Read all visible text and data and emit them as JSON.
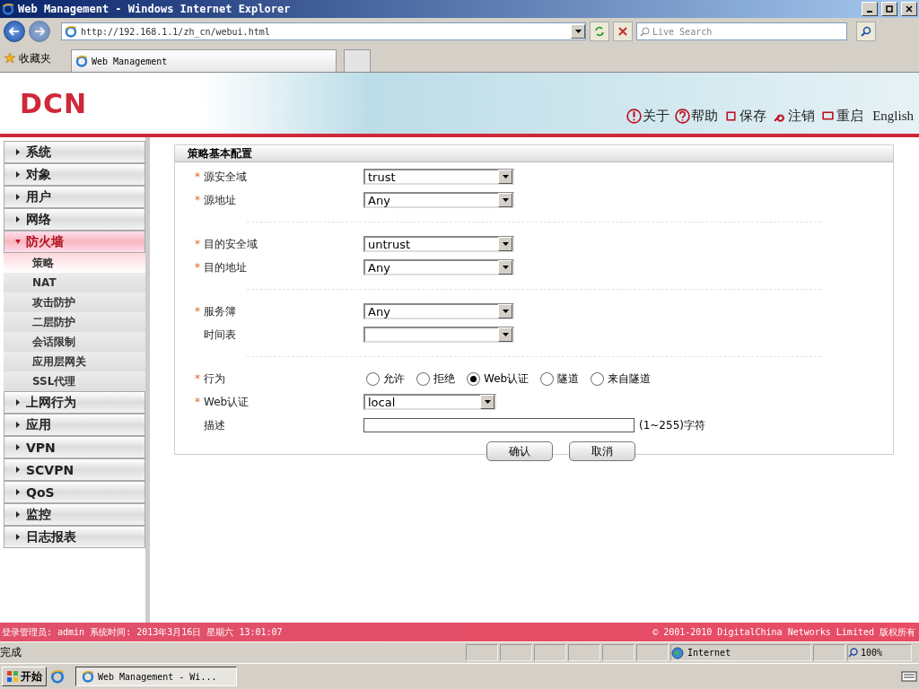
{
  "window": {
    "title": "Web Management - Windows Internet Explorer"
  },
  "browser": {
    "address": "http://192.168.1.1/zh_cn/webui.html",
    "search_placeholder": "Live Search",
    "favorites": "收藏夹",
    "tab": "Web Management"
  },
  "header": {
    "logo": "DCN",
    "actions": [
      {
        "label": "关于"
      },
      {
        "label": "帮助"
      },
      {
        "label": "保存"
      },
      {
        "label": "注销"
      },
      {
        "label": "重启"
      }
    ],
    "language": "English"
  },
  "sidebar": {
    "items": [
      {
        "label": "系统",
        "expanded": false
      },
      {
        "label": "对象",
        "expanded": false
      },
      {
        "label": "用户",
        "expanded": false
      },
      {
        "label": "网络",
        "expanded": false
      },
      {
        "label": "防火墙",
        "expanded": true,
        "children": [
          {
            "label": "策略",
            "selected": true
          },
          {
            "label": "NAT",
            "selected": false
          },
          {
            "label": "攻击防护",
            "selected": false
          },
          {
            "label": "二层防护",
            "selected": false
          },
          {
            "label": "会话限制",
            "selected": false
          },
          {
            "label": "应用层网关",
            "selected": false
          },
          {
            "label": "SSL代理",
            "selected": false
          }
        ]
      },
      {
        "label": "上网行为",
        "expanded": false
      },
      {
        "label": "应用",
        "expanded": false
      },
      {
        "label": "VPN",
        "expanded": false
      },
      {
        "label": "SCVPN",
        "expanded": false
      },
      {
        "label": "QoS",
        "expanded": false
      },
      {
        "label": "监控",
        "expanded": false
      },
      {
        "label": "日志报表",
        "expanded": false
      }
    ]
  },
  "form": {
    "title": "策略基本配置",
    "groups": [
      [
        {
          "kind": "select",
          "marker": "*",
          "label": "源安全域",
          "value": "trust"
        },
        {
          "kind": "select",
          "marker": "*",
          "label": "源地址",
          "value": "Any"
        }
      ],
      [
        {
          "kind": "select",
          "marker": "*",
          "label": "目的安全域",
          "value": "untrust"
        },
        {
          "kind": "select",
          "marker": "*",
          "label": "目的地址",
          "value": "Any"
        }
      ],
      [
        {
          "kind": "select",
          "marker": "*",
          "label": "服务簿",
          "value": "Any"
        },
        {
          "kind": "select",
          "label": "时间表"
        }
      ],
      [
        {
          "kind": "radio",
          "marker": "*",
          "label": "行为",
          "options": [
            {
              "label": "允许",
              "selected": false
            },
            {
              "label": "拒绝",
              "selected": false
            },
            {
              "label": "Web认证",
              "selected": true
            },
            {
              "label": "隧道",
              "selected": false
            },
            {
              "label": "来自隧道",
              "selected": false
            }
          ]
        },
        {
          "kind": "short_select",
          "marker": "*",
          "label": "Web认证",
          "value": "local"
        },
        {
          "kind": "text",
          "label": "描述",
          "hint": "(1~255)字符"
        }
      ]
    ],
    "buttons": [
      "确认",
      "取消"
    ]
  },
  "footer": {
    "login": "登录管理员: admin 系统时间: 2013年3月16日 星期六 13:01:07",
    "copyright": "© 2001-2010 DigitalChina Networks Limited 版权所有"
  },
  "status_bar": {
    "status": "完成",
    "zone": "Internet",
    "zoom": "100%"
  },
  "taskbar": {
    "start": "开始",
    "task": "Web Management - Wi..."
  }
}
